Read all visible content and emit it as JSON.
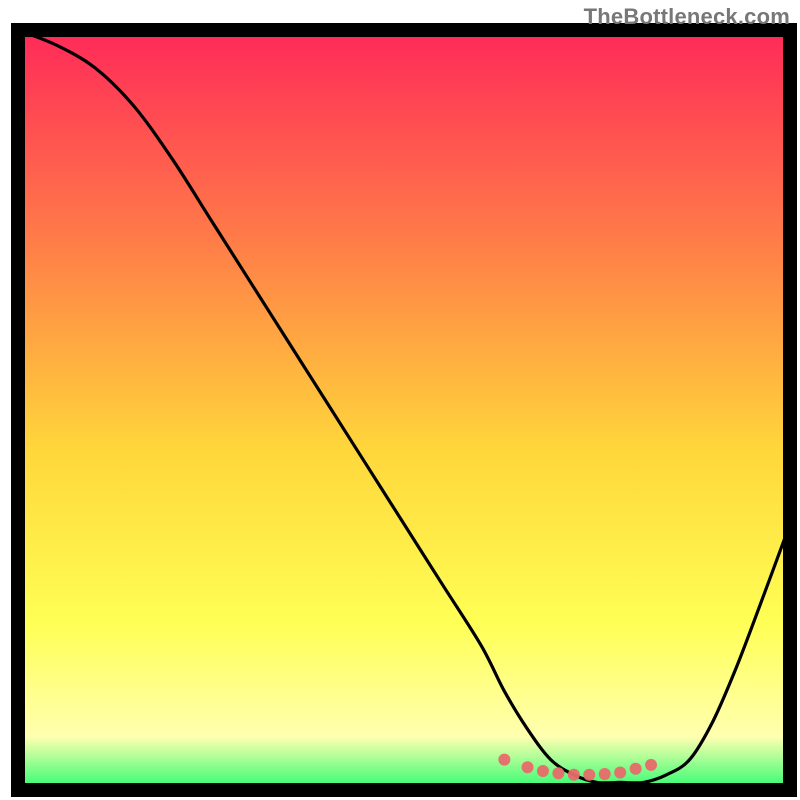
{
  "watermark": "TheBottleneck.com",
  "chart_data": {
    "type": "line",
    "title": "",
    "xlabel": "",
    "ylabel": "",
    "xlim": [
      0,
      100
    ],
    "ylim": [
      0,
      100
    ],
    "grid": false,
    "legend": false,
    "annotations": [],
    "background_gradient": {
      "top": "#ff2959",
      "mid1": "#ff7d48",
      "mid2": "#ffd63b",
      "mid3": "#ffff55",
      "mid4": "#ffffb0",
      "bottom": "#2cfc70"
    },
    "series": [
      {
        "name": "curve",
        "color": "#000000",
        "x": [
          0,
          5,
          10,
          15,
          20,
          25,
          30,
          35,
          40,
          45,
          50,
          55,
          60,
          63,
          66,
          69,
          72,
          75,
          78,
          81,
          84,
          87,
          90,
          93,
          96,
          100
        ],
        "values": [
          100,
          98,
          95,
          90,
          83,
          75,
          67,
          59,
          51,
          43,
          35,
          27,
          19,
          13,
          8,
          4,
          2,
          1,
          1,
          1,
          2,
          4,
          9,
          16,
          24,
          35
        ]
      },
      {
        "name": "trough-markers",
        "color": "#e86a6a",
        "type": "scatter",
        "x": [
          63,
          66,
          68,
          70,
          72,
          74,
          76,
          78,
          80,
          82
        ],
        "values": [
          4,
          3,
          2.5,
          2.2,
          2,
          2,
          2.1,
          2.3,
          2.8,
          3.3
        ]
      }
    ]
  }
}
